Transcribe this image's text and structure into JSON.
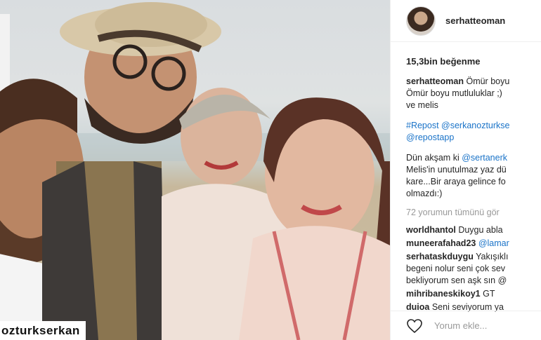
{
  "post": {
    "author": "serhatteoman",
    "likes": "15,3bin beğenme",
    "caption": {
      "user": "serhatteoman",
      "line1": "Ömür boyu",
      "line2": "Ömür boyu mutluluklar ;)",
      "line3": "ve melis"
    },
    "repost": {
      "line1": "#Repost @serkanozturkse",
      "line2": "@repostapp"
    },
    "story": {
      "line1_pre": "Dün akşam ki ",
      "line1_tag": "@sertanerk",
      "line2": "Melis'in unutulmaz yaz dü",
      "line3": "kare...Bir araya gelince fo",
      "line4": "olmazdı:)"
    },
    "view_all": "72 yorumun tümünü gör",
    "comments": [
      {
        "user": "worldhantol",
        "text": "Duygu abla"
      },
      {
        "user": "muneerafahad23",
        "text": "@lamar"
      },
      {
        "user": "serhataskduygu",
        "text": "Yakışıklı",
        "text2": "begeni nolur seni çok sev",
        "text3": "bekliyorum sen aşk sın @"
      },
      {
        "user": "mihribaneskikoy1",
        "text": "GT"
      },
      {
        "user": "duioa",
        "text": "Seni seviyorum ya"
      }
    ],
    "add_comment_placeholder": "Yorum ekle..."
  },
  "photo": {
    "watermark": "ozturkserkan"
  },
  "icons": {
    "heart": "heart-icon"
  },
  "colors": {
    "link": "#1a73c8",
    "muted": "#999999",
    "text": "#262626"
  }
}
